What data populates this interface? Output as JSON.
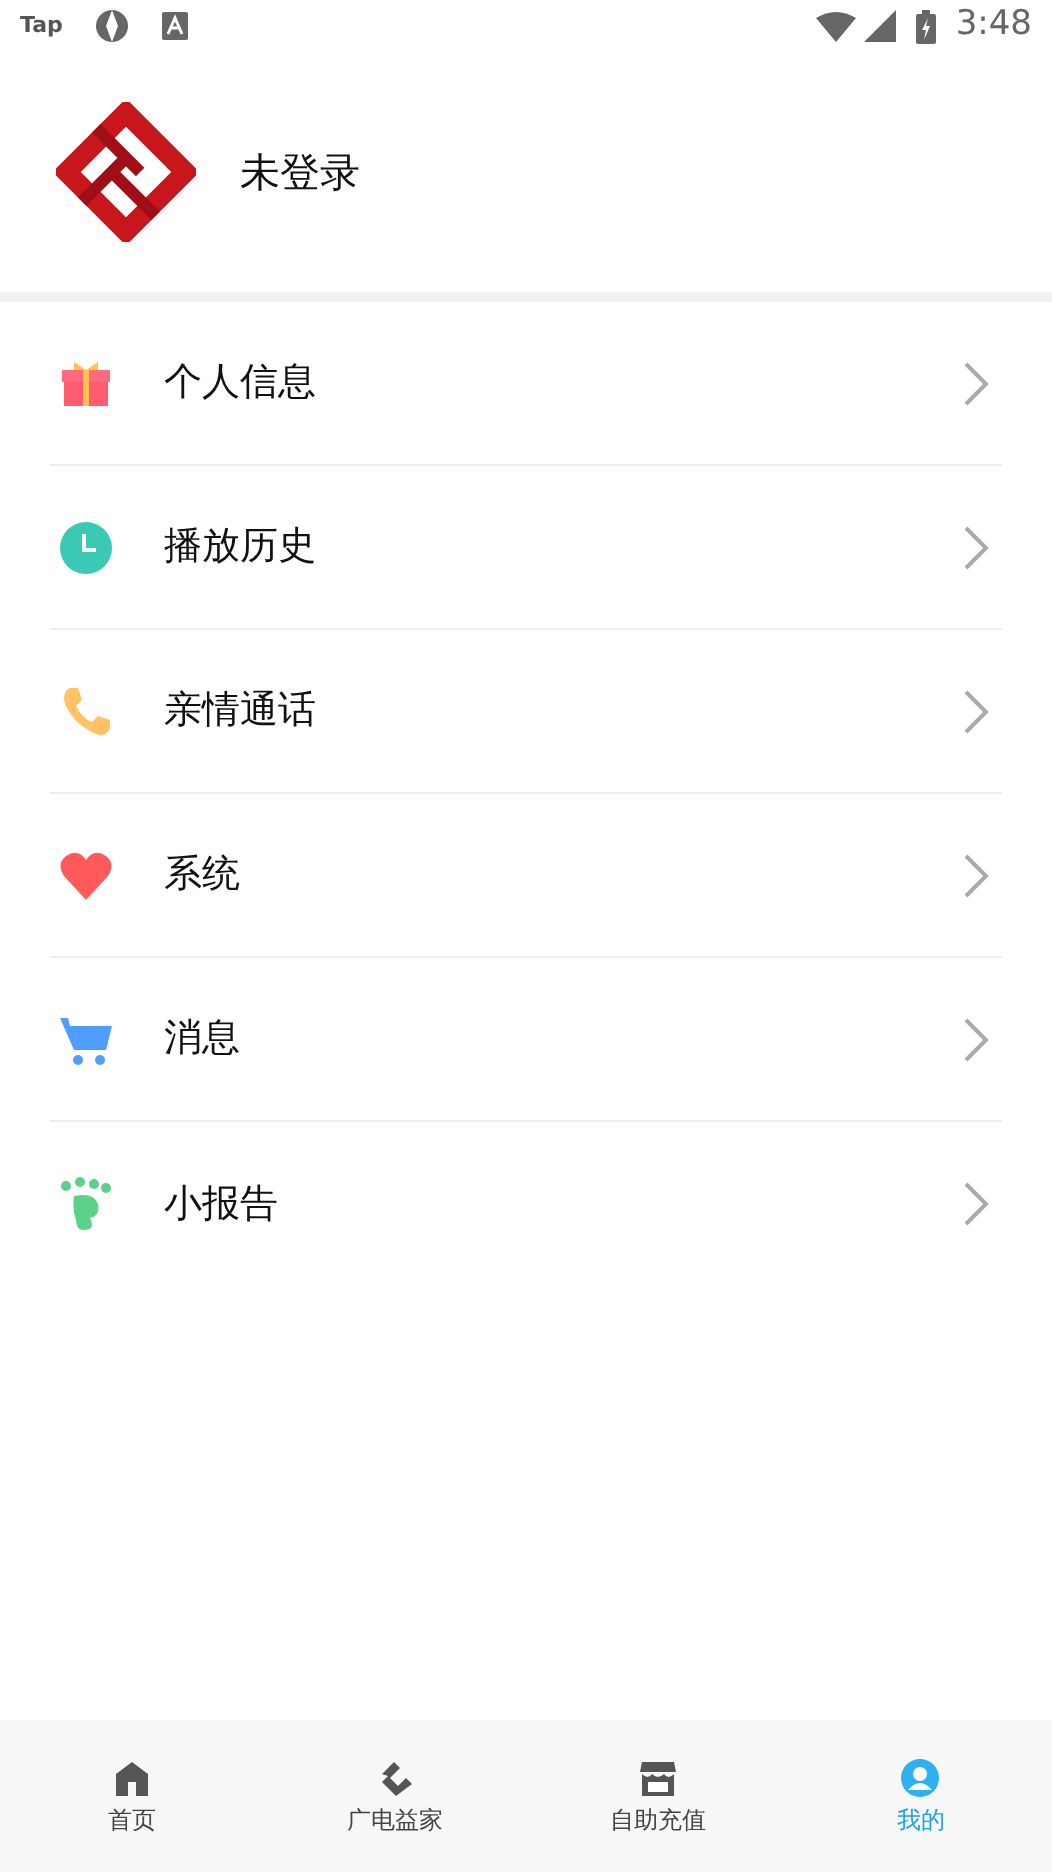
{
  "status_bar": {
    "app_label": "Tap",
    "time": "3:48"
  },
  "profile": {
    "name": "未登录"
  },
  "menu": [
    {
      "label": "个人信息",
      "kind": "gift"
    },
    {
      "label": "播放历史",
      "kind": "clock"
    },
    {
      "label": "亲情通话",
      "kind": "phone"
    },
    {
      "label": "系统",
      "kind": "heart"
    },
    {
      "label": "消息",
      "kind": "cart"
    },
    {
      "label": "小报告",
      "kind": "foot"
    }
  ],
  "tabs": [
    {
      "label": "首页",
      "kind": "home",
      "selected": false
    },
    {
      "label": "广电益家",
      "kind": "brand",
      "selected": false
    },
    {
      "label": "自助充值",
      "kind": "store",
      "selected": false
    },
    {
      "label": "我的",
      "kind": "user",
      "selected": true
    }
  ]
}
